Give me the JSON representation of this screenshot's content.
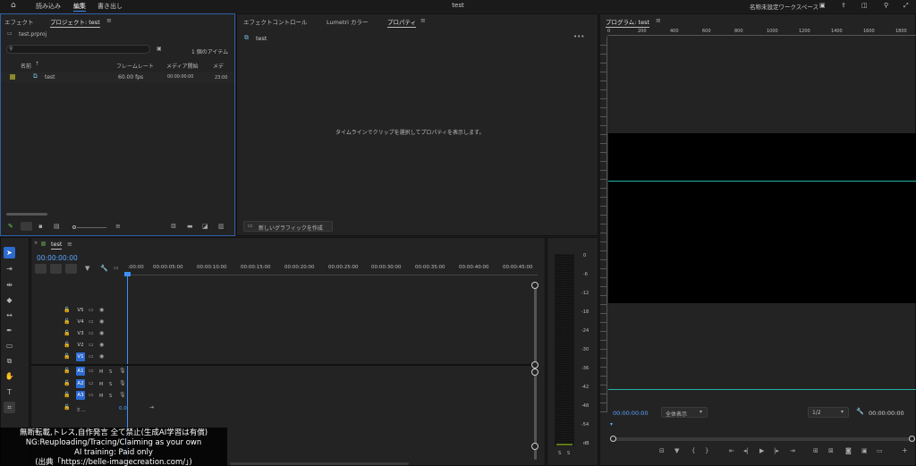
{
  "menubar": {
    "home_icon": "home-icon",
    "import": "読み込み",
    "edit": "編集",
    "export": "書き出し",
    "title": "test",
    "workspace": "名称未設定ワークスペース"
  },
  "project_panel": {
    "tab_effects": "エフェクト",
    "tab_project": "プロジェクト: test",
    "file": "test.prproj",
    "search_placeholder": "",
    "item_count": "1 個のアイテム",
    "col_name": "名前",
    "col_framerate": "フレームレート",
    "col_media_start": "メディア開始",
    "col_media_end": "メデ",
    "row_name": "test",
    "row_fps": "60.00 fps",
    "row_start": "00:00:00:00",
    "row_end": "23:00"
  },
  "properties_panel": {
    "tab_effect_controls": "エフェクトコントロール",
    "tab_lumetri": "Lumetri カラー",
    "tab_properties": "プロパティ",
    "seq_name": "test",
    "empty_message": "タイムラインでクリップを選択してプロパティを表示します。",
    "new_graphic_button": "新しいグラフィックを作成"
  },
  "program_monitor": {
    "tab": "プログラム: test",
    "ruler_labels": [
      "0",
      "200",
      "400",
      "600",
      "800",
      "1000",
      "1200",
      "1400",
      "1600",
      "1800"
    ],
    "timecode_left": "00:00:00:00",
    "fit": "全体表示",
    "resolution": "1/2",
    "timecode_right": "00:00:00:00"
  },
  "timeline": {
    "tab": "test",
    "timecode": "00:00:00:00",
    "ruler_labels": [
      ":00:00",
      "00:00:05:00",
      "00:00:10:00",
      "00:00:15:00",
      "00:00:20:00",
      "00:00:25:00",
      "00:00:30:00",
      "00:00:35:00",
      "00:00:40:00",
      "00:00:45:00"
    ],
    "video_tracks": [
      "V5",
      "V4",
      "V3",
      "V2",
      "V1"
    ],
    "audio_tracks": [
      "A1",
      "A2",
      "A3"
    ],
    "mix_label": "ミ...",
    "mix_value": "0.0",
    "m_label": "M",
    "s_label": "S"
  },
  "audio_meter": {
    "labels": [
      "0",
      "-6",
      "-12",
      "-18",
      "-24",
      "-30",
      "-36",
      "-42",
      "-48",
      "-54",
      "dB"
    ],
    "s_left": "S",
    "s_right": "S"
  },
  "watermark": {
    "line1": "無断転載,トレス,自作発言 全て禁止(生成AI学習は有償)",
    "line2": "NG:Reuploading/Tracing/Claiming as your own",
    "line3": "AI training: Paid only",
    "line4": "(出典「https://belle-imagecreation.com/」)"
  },
  "colors": {
    "accent": "#2d6bd1",
    "playhead": "#3d8ff7",
    "monitor_line": "#22b3a8"
  }
}
